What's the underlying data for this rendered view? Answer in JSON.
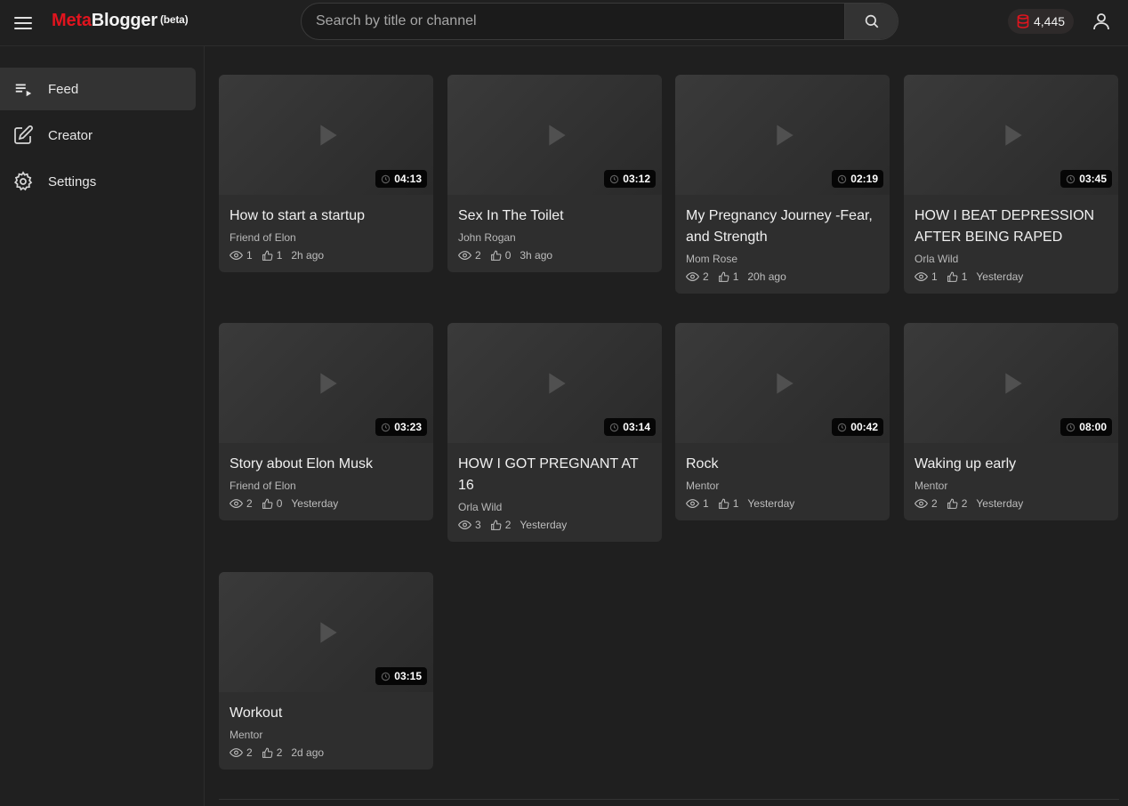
{
  "header": {
    "logo_meta": "Meta",
    "logo_blogger": "Blogger",
    "logo_beta": "(beta)",
    "search_placeholder": "Search by title or channel",
    "credits": "4,445"
  },
  "sidebar": {
    "items": [
      {
        "label": "Feed"
      },
      {
        "label": "Creator"
      },
      {
        "label": "Settings"
      }
    ]
  },
  "videos": [
    {
      "title": "How to start a startup",
      "channel": "Friend of Elon",
      "views": "1",
      "likes": "1",
      "time": "2h ago",
      "duration": "04:13"
    },
    {
      "title": "Sex In The Toilet",
      "channel": "John Rogan",
      "views": "2",
      "likes": "0",
      "time": "3h ago",
      "duration": "03:12"
    },
    {
      "title": "My Pregnancy Journey -Fear, and Strength",
      "channel": "Mom Rose",
      "views": "2",
      "likes": "1",
      "time": "20h ago",
      "duration": "02:19"
    },
    {
      "title": "HOW I BEAT DEPRESSION AFTER BEING RAPED",
      "channel": "Orla Wild",
      "views": "1",
      "likes": "1",
      "time": "Yesterday",
      "duration": "03:45"
    },
    {
      "title": "Story about Elon Musk",
      "channel": "Friend of Elon",
      "views": "2",
      "likes": "0",
      "time": "Yesterday",
      "duration": "03:23"
    },
    {
      "title": "HOW I GOT PREGNANT AT 16",
      "channel": "Orla Wild",
      "views": "3",
      "likes": "2",
      "time": "Yesterday",
      "duration": "03:14"
    },
    {
      "title": "Rock",
      "channel": "Mentor",
      "views": "1",
      "likes": "1",
      "time": "Yesterday",
      "duration": "00:42"
    },
    {
      "title": "Waking up early",
      "channel": "Mentor",
      "views": "2",
      "likes": "2",
      "time": "Yesterday",
      "duration": "08:00"
    },
    {
      "title": "Workout",
      "channel": "Mentor",
      "views": "2",
      "likes": "2",
      "time": "2d ago",
      "duration": "03:15"
    }
  ],
  "colors": {
    "brand_red": "#e0141e",
    "background": "#1f1f1f",
    "card": "#2e2e2e"
  },
  "icons": {
    "menu": "hamburger-icon",
    "search": "search-icon",
    "credits": "database-icon",
    "user": "user-icon",
    "feed": "playlist-icon",
    "creator": "edit-icon",
    "settings": "gear-icon",
    "duration": "clock-icon",
    "views": "eye-icon",
    "likes": "thumb-up-icon"
  }
}
